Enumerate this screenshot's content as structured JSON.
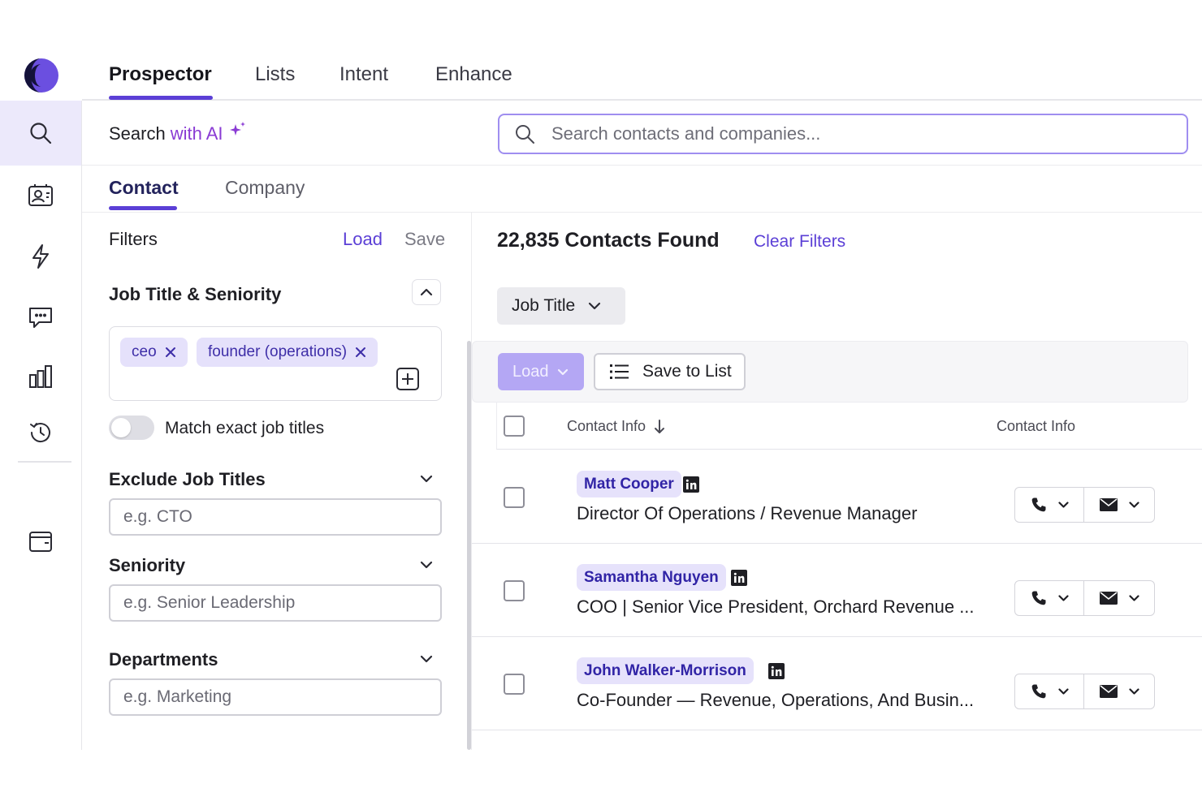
{
  "top_nav": {
    "tabs": [
      "Prospector",
      "Lists",
      "Intent",
      "Enhance"
    ],
    "active": "Prospector"
  },
  "sidebar": {
    "items": [
      "search-icon",
      "contact-card-icon",
      "lightning-icon",
      "chat-icon",
      "bar-chart-icon",
      "history-icon",
      "wallet-icon"
    ]
  },
  "ai_search": {
    "label_prefix": "Search",
    "label_ai": "with AI",
    "placeholder": "Search contacts and companies..."
  },
  "subtabs": {
    "items": [
      "Contact",
      "Company"
    ],
    "active": "Contact"
  },
  "filters": {
    "title": "Filters",
    "load": "Load",
    "save": "Save",
    "job_title_section": "Job Title & Seniority",
    "tags": [
      "ceo",
      "founder (operations)"
    ],
    "toggle_label": "Match exact job titles",
    "toggle_on": false,
    "exclude_label": "Exclude Job Titles",
    "exclude_placeholder": "e.g. CTO",
    "seniority_label": "Seniority",
    "seniority_placeholder": "e.g. Senior Leadership",
    "departments_label": "Departments",
    "departments_placeholder": "e.g. Marketing"
  },
  "results": {
    "count_text": "22,835 Contacts Found",
    "clear_filters": "Clear Filters",
    "job_title_dropdown": "Job Title",
    "load_button": "Load",
    "save_to_list": "Save to List",
    "col_contact_info": "Contact Info",
    "col_contact_info_2": "Contact Info",
    "rows": [
      {
        "name": "Matt Cooper",
        "title": "Director Of Operations / Revenue Manager"
      },
      {
        "name": "Samantha Nguyen",
        "title": "COO | Senior Vice President, Orchard Revenue ..."
      },
      {
        "name": "John Walker-Morrison",
        "title": "Co-Founder — Revenue, Operations, And Busin..."
      }
    ]
  },
  "colors": {
    "accent": "#5b3fd6",
    "ai": "#8a3bd4",
    "chip_bg": "#e6e2fb",
    "chip_text": "#3124a6"
  }
}
